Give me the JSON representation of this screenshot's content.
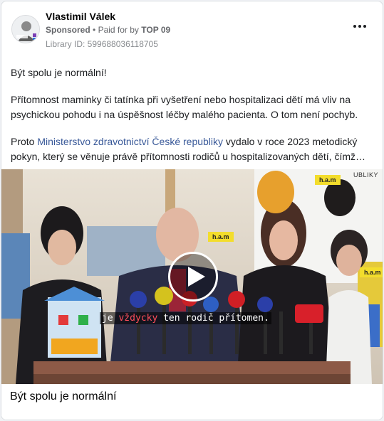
{
  "post": {
    "page_name": "Vlastimil Válek",
    "sponsored": "Sponsored",
    "paid_for_by": "Paid for by",
    "payer": "TOP 09",
    "library_id": "Library ID: 599688036118705",
    "paragraph1": "Být spolu je normální!",
    "paragraph2": "Přítomnost maminky či tatínka při vyšetření nebo hospitalizaci dětí má vliv na psychickou pohodu i na úspěšnost léčby malého pacienta. O tom není pochyb.",
    "paragraph3_pre": "Proto ",
    "link1": "Ministerstvo zdravotnictví",
    "link2": "České republiky",
    "paragraph3_post": " vydalo v roce 2023 metodický pokyn, který se věnuje právě přítomnosti rodičů u hospitalizovaných dětí, čímž…",
    "caption": "Být spolu je normální"
  },
  "video": {
    "subtitle_pre": "je ",
    "subtitle_highlight": "vždycky",
    "subtitle_post": " ten rodič přítomen.",
    "banner_text": "h.a.m",
    "corner_text": "UBLIKY"
  },
  "icons": {
    "more": "more-horizontal-icon",
    "play": "play-icon"
  },
  "colors": {
    "link": "#385898",
    "subtitle_highlight": "#ff4e5b",
    "banner": "#f3dd2c"
  }
}
